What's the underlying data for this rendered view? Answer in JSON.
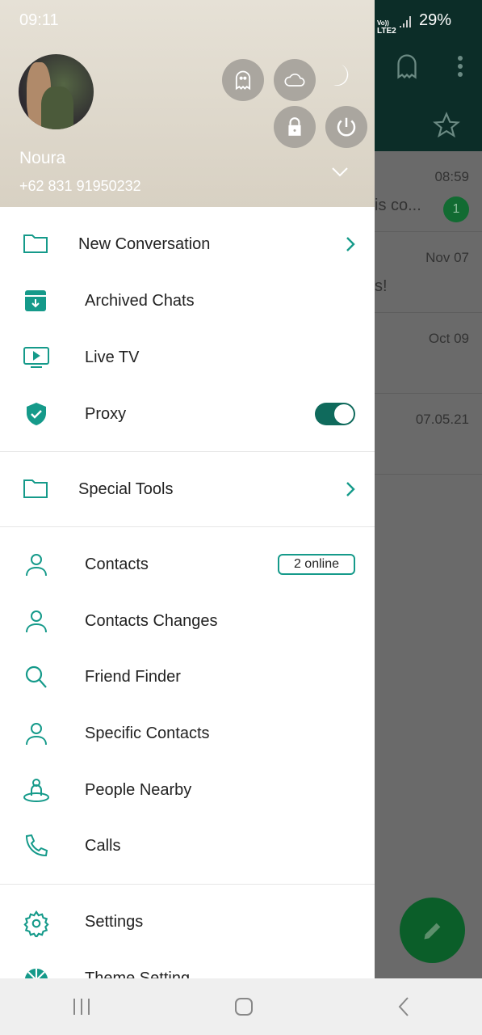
{
  "status": {
    "time": "09:11",
    "battery": "29%",
    "network": "LTE2"
  },
  "profile": {
    "name": "Noura",
    "phone": "+62 831 91950232"
  },
  "menu": [
    {
      "label": "New Conversation",
      "icon": "folder-icon",
      "chevron": true
    },
    {
      "label": "Archived Chats",
      "icon": "archive-icon"
    },
    {
      "label": "Live TV",
      "icon": "tv-icon"
    },
    {
      "label": "Proxy",
      "icon": "shield-check-icon",
      "toggle": true
    },
    {
      "label": "Special Tools",
      "icon": "folder-icon",
      "chevron": true
    },
    {
      "label": "Contacts",
      "icon": "person-icon",
      "badge": "2 online"
    },
    {
      "label": "Contacts Changes",
      "icon": "person-icon"
    },
    {
      "label": "Friend Finder",
      "icon": "search-icon"
    },
    {
      "label": "Specific Contacts",
      "icon": "person-icon"
    },
    {
      "label": "People Nearby",
      "icon": "people-nearby-icon"
    },
    {
      "label": "Calls",
      "icon": "phone-icon"
    },
    {
      "label": "Settings",
      "icon": "gear-icon"
    },
    {
      "label": "Theme Setting",
      "icon": "palette-icon"
    }
  ],
  "proxy_enabled": true,
  "chats": [
    {
      "time": "08:59",
      "snippet": "is co...",
      "unread": "1"
    },
    {
      "time": "Nov 07",
      "snippet": "s!"
    },
    {
      "time": "Oct 09",
      "snippet": ""
    },
    {
      "time": "07.05.21",
      "snippet": ""
    }
  ],
  "colors": {
    "accent": "#159a8a",
    "topbar": "#0c2d28",
    "fab": "#0b5e29"
  }
}
